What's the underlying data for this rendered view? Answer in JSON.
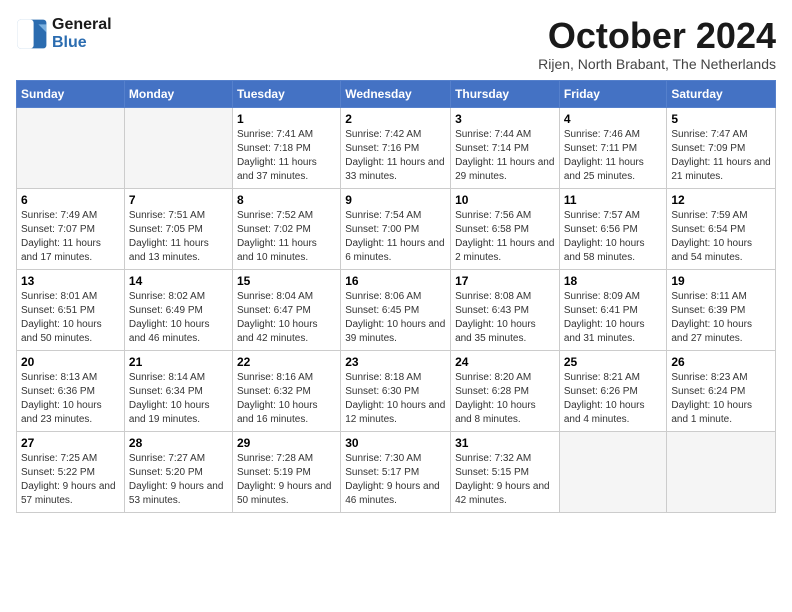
{
  "header": {
    "logo_line1": "General",
    "logo_line2": "Blue",
    "month_title": "October 2024",
    "location": "Rijen, North Brabant, The Netherlands"
  },
  "weekdays": [
    "Sunday",
    "Monday",
    "Tuesday",
    "Wednesday",
    "Thursday",
    "Friday",
    "Saturday"
  ],
  "weeks": [
    [
      {
        "day": "",
        "empty": true
      },
      {
        "day": "",
        "empty": true
      },
      {
        "day": "1",
        "sunrise": "Sunrise: 7:41 AM",
        "sunset": "Sunset: 7:18 PM",
        "daylight": "Daylight: 11 hours and 37 minutes."
      },
      {
        "day": "2",
        "sunrise": "Sunrise: 7:42 AM",
        "sunset": "Sunset: 7:16 PM",
        "daylight": "Daylight: 11 hours and 33 minutes."
      },
      {
        "day": "3",
        "sunrise": "Sunrise: 7:44 AM",
        "sunset": "Sunset: 7:14 PM",
        "daylight": "Daylight: 11 hours and 29 minutes."
      },
      {
        "day": "4",
        "sunrise": "Sunrise: 7:46 AM",
        "sunset": "Sunset: 7:11 PM",
        "daylight": "Daylight: 11 hours and 25 minutes."
      },
      {
        "day": "5",
        "sunrise": "Sunrise: 7:47 AM",
        "sunset": "Sunset: 7:09 PM",
        "daylight": "Daylight: 11 hours and 21 minutes."
      }
    ],
    [
      {
        "day": "6",
        "sunrise": "Sunrise: 7:49 AM",
        "sunset": "Sunset: 7:07 PM",
        "daylight": "Daylight: 11 hours and 17 minutes."
      },
      {
        "day": "7",
        "sunrise": "Sunrise: 7:51 AM",
        "sunset": "Sunset: 7:05 PM",
        "daylight": "Daylight: 11 hours and 13 minutes."
      },
      {
        "day": "8",
        "sunrise": "Sunrise: 7:52 AM",
        "sunset": "Sunset: 7:02 PM",
        "daylight": "Daylight: 11 hours and 10 minutes."
      },
      {
        "day": "9",
        "sunrise": "Sunrise: 7:54 AM",
        "sunset": "Sunset: 7:00 PM",
        "daylight": "Daylight: 11 hours and 6 minutes."
      },
      {
        "day": "10",
        "sunrise": "Sunrise: 7:56 AM",
        "sunset": "Sunset: 6:58 PM",
        "daylight": "Daylight: 11 hours and 2 minutes."
      },
      {
        "day": "11",
        "sunrise": "Sunrise: 7:57 AM",
        "sunset": "Sunset: 6:56 PM",
        "daylight": "Daylight: 10 hours and 58 minutes."
      },
      {
        "day": "12",
        "sunrise": "Sunrise: 7:59 AM",
        "sunset": "Sunset: 6:54 PM",
        "daylight": "Daylight: 10 hours and 54 minutes."
      }
    ],
    [
      {
        "day": "13",
        "sunrise": "Sunrise: 8:01 AM",
        "sunset": "Sunset: 6:51 PM",
        "daylight": "Daylight: 10 hours and 50 minutes."
      },
      {
        "day": "14",
        "sunrise": "Sunrise: 8:02 AM",
        "sunset": "Sunset: 6:49 PM",
        "daylight": "Daylight: 10 hours and 46 minutes."
      },
      {
        "day": "15",
        "sunrise": "Sunrise: 8:04 AM",
        "sunset": "Sunset: 6:47 PM",
        "daylight": "Daylight: 10 hours and 42 minutes."
      },
      {
        "day": "16",
        "sunrise": "Sunrise: 8:06 AM",
        "sunset": "Sunset: 6:45 PM",
        "daylight": "Daylight: 10 hours and 39 minutes."
      },
      {
        "day": "17",
        "sunrise": "Sunrise: 8:08 AM",
        "sunset": "Sunset: 6:43 PM",
        "daylight": "Daylight: 10 hours and 35 minutes."
      },
      {
        "day": "18",
        "sunrise": "Sunrise: 8:09 AM",
        "sunset": "Sunset: 6:41 PM",
        "daylight": "Daylight: 10 hours and 31 minutes."
      },
      {
        "day": "19",
        "sunrise": "Sunrise: 8:11 AM",
        "sunset": "Sunset: 6:39 PM",
        "daylight": "Daylight: 10 hours and 27 minutes."
      }
    ],
    [
      {
        "day": "20",
        "sunrise": "Sunrise: 8:13 AM",
        "sunset": "Sunset: 6:36 PM",
        "daylight": "Daylight: 10 hours and 23 minutes."
      },
      {
        "day": "21",
        "sunrise": "Sunrise: 8:14 AM",
        "sunset": "Sunset: 6:34 PM",
        "daylight": "Daylight: 10 hours and 19 minutes."
      },
      {
        "day": "22",
        "sunrise": "Sunrise: 8:16 AM",
        "sunset": "Sunset: 6:32 PM",
        "daylight": "Daylight: 10 hours and 16 minutes."
      },
      {
        "day": "23",
        "sunrise": "Sunrise: 8:18 AM",
        "sunset": "Sunset: 6:30 PM",
        "daylight": "Daylight: 10 hours and 12 minutes."
      },
      {
        "day": "24",
        "sunrise": "Sunrise: 8:20 AM",
        "sunset": "Sunset: 6:28 PM",
        "daylight": "Daylight: 10 hours and 8 minutes."
      },
      {
        "day": "25",
        "sunrise": "Sunrise: 8:21 AM",
        "sunset": "Sunset: 6:26 PM",
        "daylight": "Daylight: 10 hours and 4 minutes."
      },
      {
        "day": "26",
        "sunrise": "Sunrise: 8:23 AM",
        "sunset": "Sunset: 6:24 PM",
        "daylight": "Daylight: 10 hours and 1 minute."
      }
    ],
    [
      {
        "day": "27",
        "sunrise": "Sunrise: 7:25 AM",
        "sunset": "Sunset: 5:22 PM",
        "daylight": "Daylight: 9 hours and 57 minutes."
      },
      {
        "day": "28",
        "sunrise": "Sunrise: 7:27 AM",
        "sunset": "Sunset: 5:20 PM",
        "daylight": "Daylight: 9 hours and 53 minutes."
      },
      {
        "day": "29",
        "sunrise": "Sunrise: 7:28 AM",
        "sunset": "Sunset: 5:19 PM",
        "daylight": "Daylight: 9 hours and 50 minutes."
      },
      {
        "day": "30",
        "sunrise": "Sunrise: 7:30 AM",
        "sunset": "Sunset: 5:17 PM",
        "daylight": "Daylight: 9 hours and 46 minutes."
      },
      {
        "day": "31",
        "sunrise": "Sunrise: 7:32 AM",
        "sunset": "Sunset: 5:15 PM",
        "daylight": "Daylight: 9 hours and 42 minutes."
      },
      {
        "day": "",
        "empty": true
      },
      {
        "day": "",
        "empty": true
      }
    ]
  ]
}
